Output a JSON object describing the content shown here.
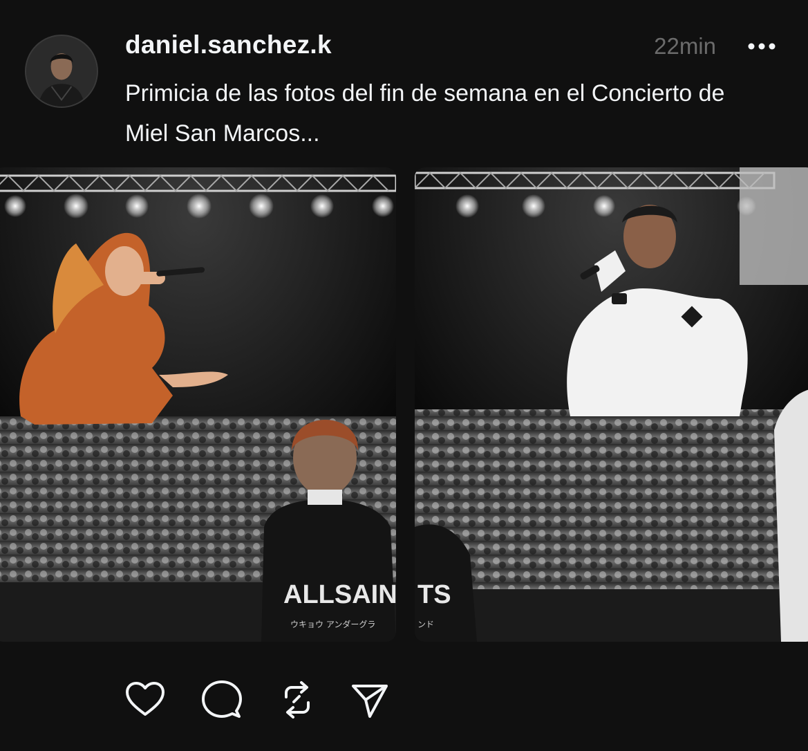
{
  "post": {
    "username": "daniel.sanchez.k",
    "timestamp": "22min",
    "caption": "Primicia de las fotos del fin de semana en el Concierto de Miel San Marcos..."
  },
  "media": [
    {
      "shirt_text": "ALLSAINTS",
      "shirt_subtext": "ウキョウ アンダーグラ"
    },
    {
      "shirt_text": "TS",
      "shirt_subtext": "ンド"
    }
  ],
  "icons": {
    "more": "more-horizontal-icon",
    "like": "heart-icon",
    "comment": "comment-bubble-icon",
    "repost": "repost-icon",
    "share": "send-icon"
  },
  "colors": {
    "background": "#101010",
    "text_primary": "#f3f5f7",
    "text_secondary": "#6b6b6b",
    "singer_orange": "#c4622a"
  }
}
